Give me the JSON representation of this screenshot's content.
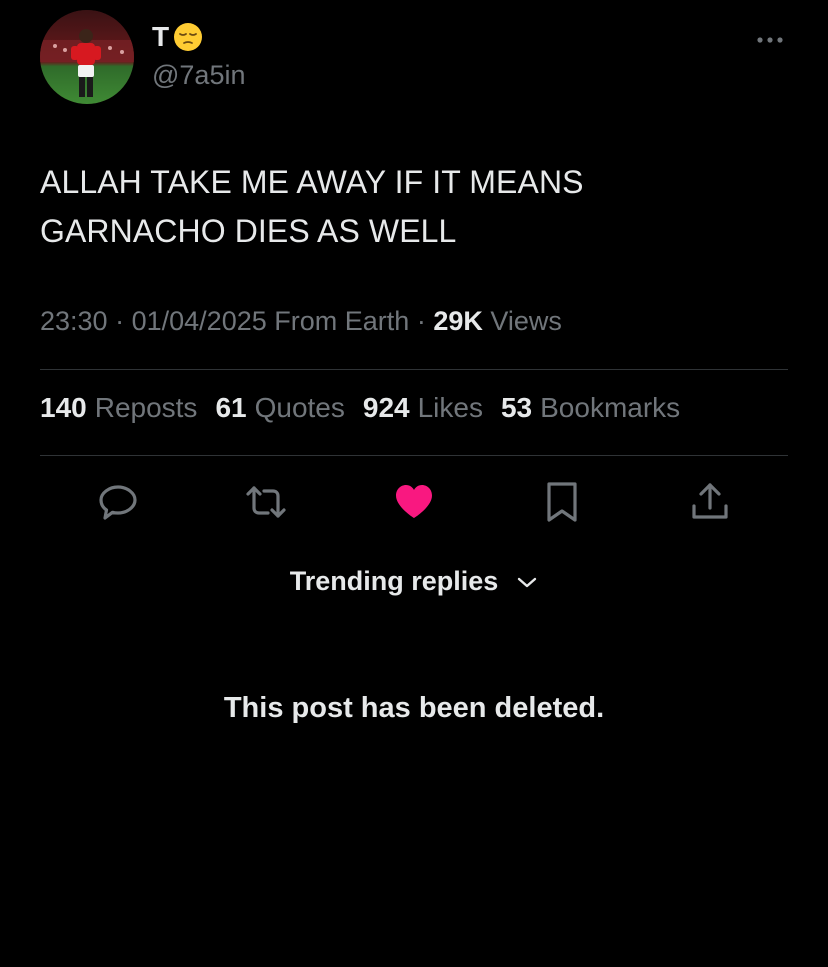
{
  "author": {
    "display_name": "T",
    "emoji": "pensive-face",
    "handle": "@7a5in"
  },
  "tweet": {
    "text_line1": "ALLAH TAKE ME AWAY IF IT MEANS",
    "text_line2": "GARNACHO DIES AS WELL"
  },
  "meta": {
    "time": "23:30",
    "date": "01/04/2025",
    "source": "From Earth",
    "views_count": "29K",
    "views_label": "Views",
    "separator": "·"
  },
  "stats": [
    {
      "count": "140",
      "label": "Reposts"
    },
    {
      "count": "61",
      "label": "Quotes"
    },
    {
      "count": "924",
      "label": "Likes"
    },
    {
      "count": "53",
      "label": "Bookmarks"
    }
  ],
  "actions": {
    "reply_icon": "reply-icon",
    "repost_icon": "repost-icon",
    "like_icon": "heart-filled-icon",
    "bookmark_icon": "bookmark-icon",
    "share_icon": "share-icon",
    "like_color": "#f91880",
    "icon_color": "#71767b"
  },
  "trending": {
    "label": "Trending replies"
  },
  "deleted_notice": "This post has been deleted."
}
